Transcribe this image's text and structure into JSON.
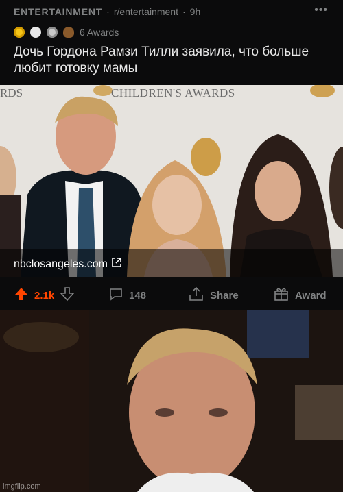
{
  "post": {
    "subreddit_label": "ENTERTAINMENT",
    "subreddit_path": "r/entertainment",
    "age": "9h",
    "awards_label": "6 Awards",
    "title": "Дочь Гордона Рамзи Тилли заявила, что больше любит готовку мамы",
    "link_domain": "nbclosangeles.com",
    "banner_text": "CHILDREN'S AWARDS",
    "banner_left_text": "RDS"
  },
  "actions": {
    "upvotes": "2.1k",
    "comments": "148",
    "share_label": "Share",
    "award_label": "Award"
  },
  "colors": {
    "upvote": "#ff4500",
    "muted": "#818384",
    "background": "#0b0b0c"
  },
  "icons": [
    "award-icon-wholesome",
    "award-icon-helpful",
    "award-icon-silver",
    "award-icon-poop",
    "more-icon",
    "external-link-icon",
    "upvote-arrow-icon",
    "downvote-arrow-icon",
    "comment-icon",
    "share-icon",
    "award-gift-icon"
  ],
  "meme": {
    "watermark": "imgflip.com"
  }
}
